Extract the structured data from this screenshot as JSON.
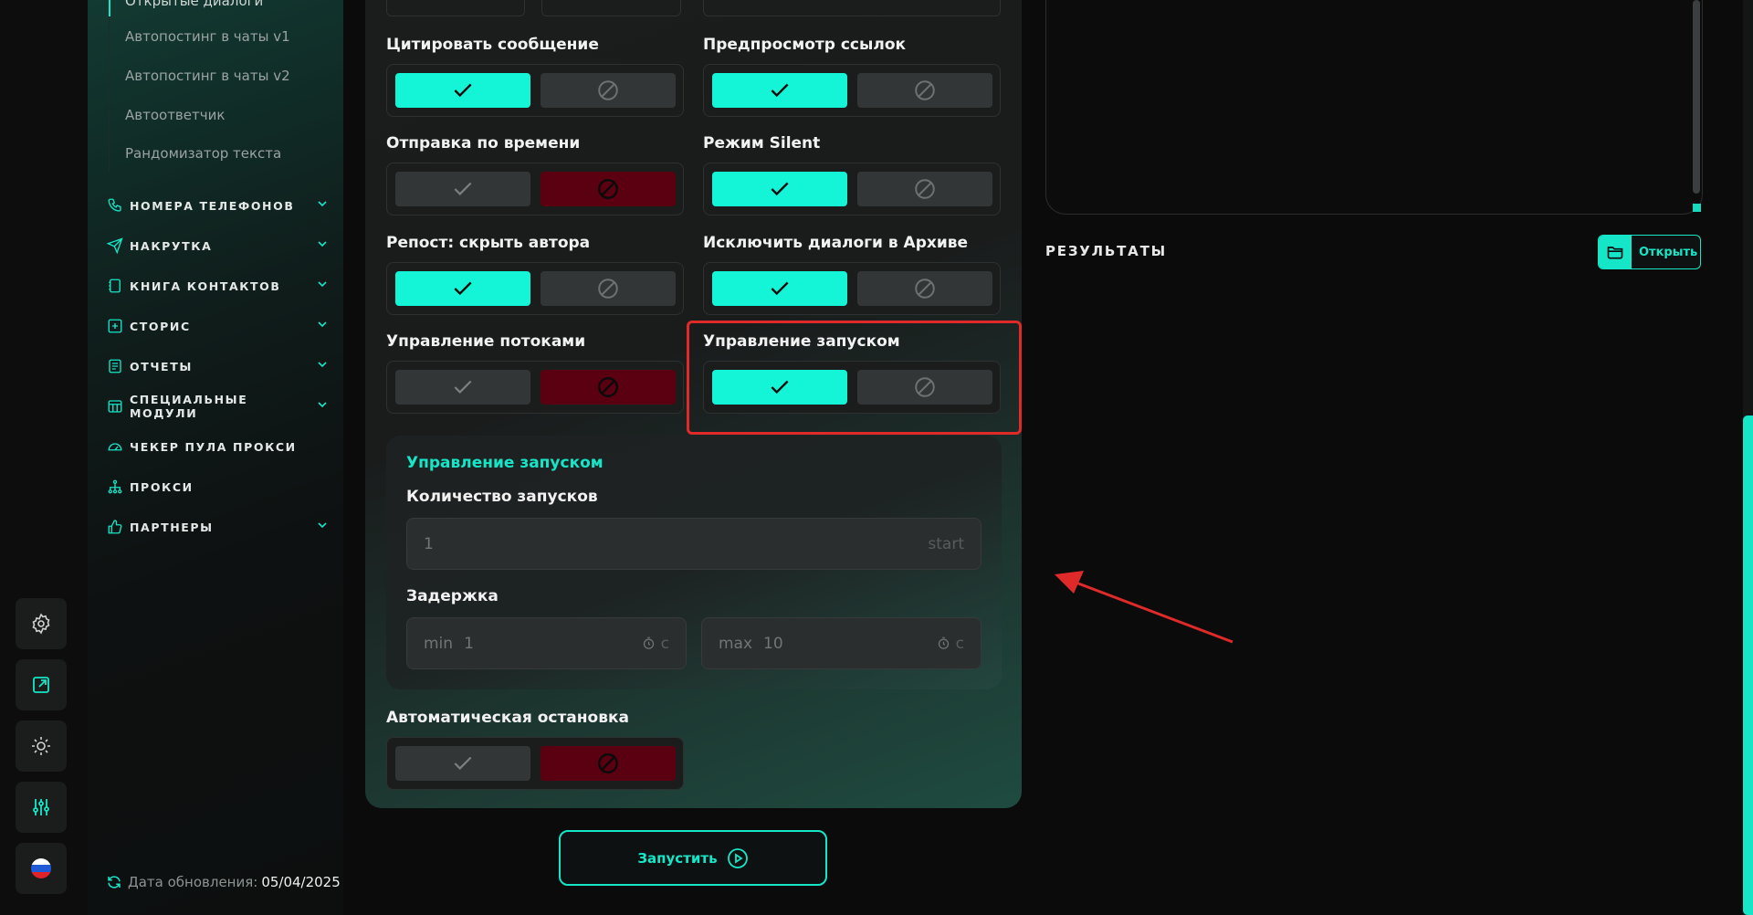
{
  "sidebar": {
    "cut_item": "Открытые диалоги",
    "sub_items": [
      "Автопостинг в чаты v1",
      "Автопостинг в чаты v2",
      "Автоответчик",
      "Рандомизатор текста"
    ],
    "items": [
      {
        "label": "НОМЕРА ТЕЛЕФОНОВ",
        "icon": "phone-icon",
        "expandable": true
      },
      {
        "label": "НАКРУТКА",
        "icon": "send-icon",
        "expandable": true
      },
      {
        "label": "КНИГА КОНТАКТОВ",
        "icon": "contacts-book-icon",
        "expandable": true
      },
      {
        "label": "СТОРИС",
        "icon": "plus-square-icon",
        "expandable": true
      },
      {
        "label": "ОТЧЕТЫ",
        "icon": "report-icon",
        "expandable": true
      },
      {
        "label": "СПЕЦИАЛЬНЫЕ МОДУЛИ",
        "icon": "modules-icon",
        "expandable": true
      },
      {
        "label": "ЧЕКЕР ПУЛА ПРОКСИ",
        "icon": "speedometer-icon",
        "expandable": false
      },
      {
        "label": "ПРОКСИ",
        "icon": "network-icon",
        "expandable": false
      },
      {
        "label": "ПАРТНЕРЫ",
        "icon": "thumbs-up-icon",
        "expandable": true
      }
    ],
    "update_label": "Дата обновления:",
    "update_value": "05/04/2025"
  },
  "rail": [
    "gear-icon",
    "external-link-icon",
    "sun-icon",
    "sliders-icon",
    "russia-flag-icon"
  ],
  "settings": {
    "quote": {
      "label": "Цитировать сообщение",
      "state": "on"
    },
    "link_preview": {
      "label": "Предпросмотр ссылок",
      "state": "on"
    },
    "scheduled": {
      "label": "Отправка по времени",
      "state": "off"
    },
    "silent": {
      "label": "Режим Silent",
      "state": "on"
    },
    "repost_hide": {
      "label": "Репост: скрыть автора",
      "state": "on"
    },
    "exclude_archive": {
      "label": "Исключить диалоги в Архиве",
      "state": "on"
    },
    "threads": {
      "label": "Управление потоками",
      "state": "off"
    },
    "launch_control": {
      "label": "Управление запуском",
      "state": "on"
    },
    "auto_stop": {
      "label": "Автоматическая остановка",
      "state": "off"
    }
  },
  "launch_panel": {
    "title": "Управление запуском",
    "count_label": "Количество запусков",
    "count_value": "1",
    "count_suffix": "start",
    "delay_label": "Задержка",
    "min_prefix": "min",
    "min_value": "1",
    "max_prefix": "max",
    "max_value": "10",
    "unit": "с"
  },
  "run_button": "Запустить",
  "results": {
    "title": "РЕЗУЛЬТАТЫ",
    "open_button": "Открыть"
  },
  "colors": {
    "accent": "#16e6c8",
    "danger": "#5b0011",
    "highlight": "#e02a2a"
  }
}
